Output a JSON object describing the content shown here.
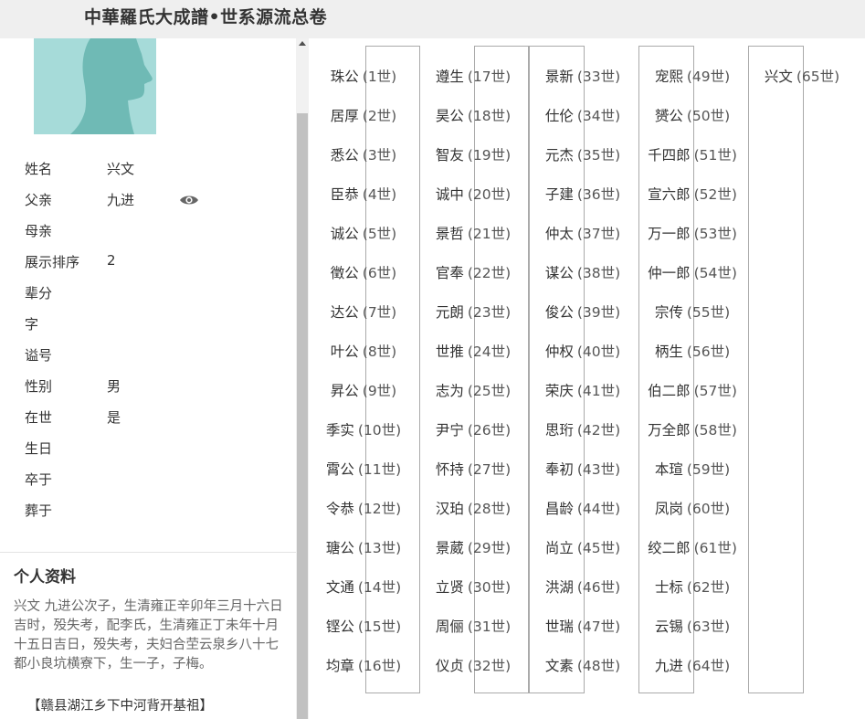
{
  "header": {
    "title": "中華羅氏大成譜•世系源流总卷"
  },
  "profile": {
    "fields": [
      {
        "label": "姓名",
        "value": "兴文"
      },
      {
        "label": "父亲",
        "value": "九进"
      },
      {
        "label": "母亲",
        "value": ""
      },
      {
        "label": "展示排序",
        "value": "2"
      },
      {
        "label": "辈分",
        "value": ""
      },
      {
        "label": "字",
        "value": ""
      },
      {
        "label": "谥号",
        "value": ""
      },
      {
        "label": "性别",
        "value": "男"
      },
      {
        "label": "在世",
        "value": "是"
      },
      {
        "label": "生日",
        "value": ""
      },
      {
        "label": "卒于",
        "value": ""
      },
      {
        "label": "葬于",
        "value": ""
      }
    ],
    "father_view_icon": "eye-icon"
  },
  "bio": {
    "title": "个人资料",
    "text": "兴文 九进公次子，生清雍正辛卯年三月十六日吉时，殁失考，配李氏，生清雍正丁未年十月十五日吉日，殁失考，夫妇合茔云泉乡八十七都小良坑横寮下，生一子，子梅。",
    "tag": "【赣县湖江乡下中河背开基祖】"
  },
  "lineage": [
    {
      "name": "珠公",
      "gen": "(1世)"
    },
    {
      "name": "居厚",
      "gen": "(2世)"
    },
    {
      "name": "悉公",
      "gen": "(3世)"
    },
    {
      "name": "臣恭",
      "gen": "(4世)"
    },
    {
      "name": "诚公",
      "gen": "(5世)"
    },
    {
      "name": "徵公",
      "gen": "(6世)"
    },
    {
      "name": "达公",
      "gen": "(7世)"
    },
    {
      "name": "叶公",
      "gen": "(8世)"
    },
    {
      "name": "昇公",
      "gen": "(9世)"
    },
    {
      "name": "季实",
      "gen": "(10世)"
    },
    {
      "name": "霄公",
      "gen": "(11世)"
    },
    {
      "name": "令恭",
      "gen": "(12世)"
    },
    {
      "name": "瑭公",
      "gen": "(13世)"
    },
    {
      "name": "文通",
      "gen": "(14世)"
    },
    {
      "name": "铿公",
      "gen": "(15世)"
    },
    {
      "name": "均章",
      "gen": "(16世)"
    },
    {
      "name": "遵生",
      "gen": "(17世)"
    },
    {
      "name": "昊公",
      "gen": "(18世)"
    },
    {
      "name": "智友",
      "gen": "(19世)"
    },
    {
      "name": "诚中",
      "gen": "(20世)"
    },
    {
      "name": "景哲",
      "gen": "(21世)"
    },
    {
      "name": "官奉",
      "gen": "(22世)"
    },
    {
      "name": "元朗",
      "gen": "(23世)"
    },
    {
      "name": "世推",
      "gen": "(24世)"
    },
    {
      "name": "志为",
      "gen": "(25世)"
    },
    {
      "name": "尹宁",
      "gen": "(26世)"
    },
    {
      "name": "怀持",
      "gen": "(27世)"
    },
    {
      "name": "汉珀",
      "gen": "(28世)"
    },
    {
      "name": "景葳",
      "gen": "(29世)"
    },
    {
      "name": "立贤",
      "gen": "(30世)"
    },
    {
      "name": "周俪",
      "gen": "(31世)"
    },
    {
      "name": "仪贞",
      "gen": "(32世)"
    },
    {
      "name": "景新",
      "gen": "(33世)"
    },
    {
      "name": "仕伦",
      "gen": "(34世)"
    },
    {
      "name": "元杰",
      "gen": "(35世)"
    },
    {
      "name": "子建",
      "gen": "(36世)"
    },
    {
      "name": "仲太",
      "gen": "(37世)"
    },
    {
      "name": "谋公",
      "gen": "(38世)"
    },
    {
      "name": "俊公",
      "gen": "(39世)"
    },
    {
      "name": "仲权",
      "gen": "(40世)"
    },
    {
      "name": "荣庆",
      "gen": "(41世)"
    },
    {
      "name": "思珩",
      "gen": "(42世)"
    },
    {
      "name": "奉初",
      "gen": "(43世)"
    },
    {
      "name": "昌龄",
      "gen": "(44世)"
    },
    {
      "name": "尚立",
      "gen": "(45世)"
    },
    {
      "name": "洪湖",
      "gen": "(46世)"
    },
    {
      "name": "世瑞",
      "gen": "(47世)"
    },
    {
      "name": "文素",
      "gen": "(48世)"
    },
    {
      "name": "宠熙",
      "gen": "(49世)"
    },
    {
      "name": "赟公",
      "gen": "(50世)"
    },
    {
      "name": "千四郎",
      "gen": "(51世)"
    },
    {
      "name": "宣六郎",
      "gen": "(52世)"
    },
    {
      "name": "万一郎",
      "gen": "(53世)"
    },
    {
      "name": "仲一郎",
      "gen": "(54世)"
    },
    {
      "name": "宗传",
      "gen": "(55世)"
    },
    {
      "name": "柄生",
      "gen": "(56世)"
    },
    {
      "name": "伯二郎",
      "gen": "(57世)"
    },
    {
      "name": "万全郎",
      "gen": "(58世)"
    },
    {
      "name": "本瑄",
      "gen": "(59世)"
    },
    {
      "name": "凤岗",
      "gen": "(60世)"
    },
    {
      "name": "绞二郎",
      "gen": "(61世)"
    },
    {
      "name": "士标",
      "gen": "(62世)"
    },
    {
      "name": "云锡",
      "gen": "(63世)"
    },
    {
      "name": "九进",
      "gen": "(64世)"
    },
    {
      "name": "兴文",
      "gen": "(65世)"
    }
  ]
}
